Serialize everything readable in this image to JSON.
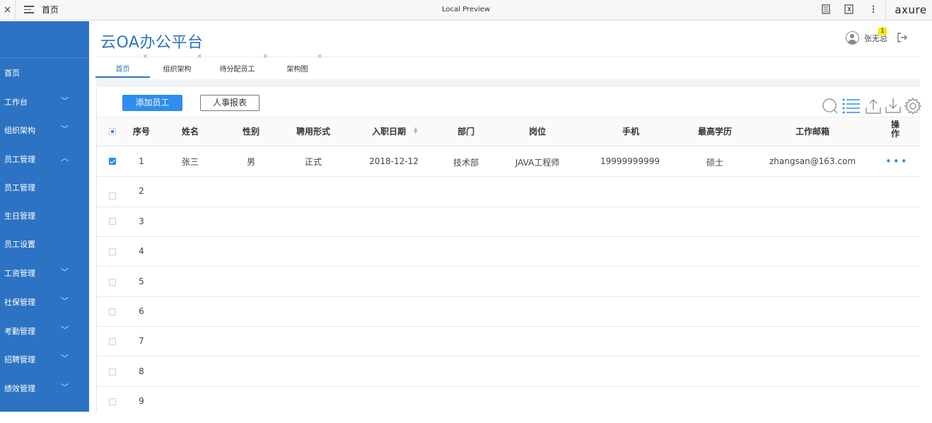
{
  "browser": {
    "close_label": "×",
    "page_label": "首页",
    "title": "Local Preview",
    "brand": "axure"
  },
  "sidebar": {
    "items": [
      {
        "label": "首页",
        "chevron": ""
      },
      {
        "label": "工作台",
        "chevron": "down"
      },
      {
        "label": "组织架构",
        "chevron": "down"
      },
      {
        "label": "员工管理",
        "chevron": "up"
      },
      {
        "label": "员工管理",
        "chevron": ""
      },
      {
        "label": "生日管理",
        "chevron": ""
      },
      {
        "label": "员工设置",
        "chevron": ""
      },
      {
        "label": "工资管理",
        "chevron": "down"
      },
      {
        "label": "社保管理",
        "chevron": "down"
      },
      {
        "label": "考勤管理",
        "chevron": "down"
      },
      {
        "label": "招聘管理",
        "chevron": "down"
      },
      {
        "label": "绩效管理",
        "chevron": "down"
      }
    ]
  },
  "header": {
    "app_title": "云OA办公平台",
    "user_name": "张无忌",
    "notification_count": "1"
  },
  "tabs": [
    {
      "label": "首页",
      "active": true
    },
    {
      "label": "组织架构",
      "active": false
    },
    {
      "label": "待分配员工",
      "active": false
    },
    {
      "label": "架构图",
      "active": false
    }
  ],
  "toolbar": {
    "add_label": "添加员工",
    "report_label": "人事报表"
  },
  "table": {
    "columns": [
      "序号",
      "姓名",
      "性别",
      "聘用形式",
      "入职日期",
      "部门",
      "岗位",
      "手机",
      "最高学历",
      "工作邮箱",
      "操作"
    ],
    "rows": [
      {
        "index": "1",
        "name": "张三",
        "gender": "男",
        "employment": "正式",
        "hire_date": "2018-12-12",
        "dept": "技术部",
        "position": "JAVA工程师",
        "phone": "19999999999",
        "education": "硕士",
        "email": "zhangsan@163.com",
        "checked": true
      },
      {
        "index": "2",
        "checked": false
      },
      {
        "index": "3",
        "checked": false
      },
      {
        "index": "4",
        "checked": false
      },
      {
        "index": "5",
        "checked": false
      },
      {
        "index": "6",
        "checked": false
      },
      {
        "index": "7",
        "checked": false
      },
      {
        "index": "8",
        "checked": false
      },
      {
        "index": "9",
        "checked": false
      }
    ],
    "ops_glyph": "•••"
  },
  "colors": {
    "sidebar": "#2d73c3",
    "primary": "#2f8cf0",
    "title": "#2d73c3"
  }
}
